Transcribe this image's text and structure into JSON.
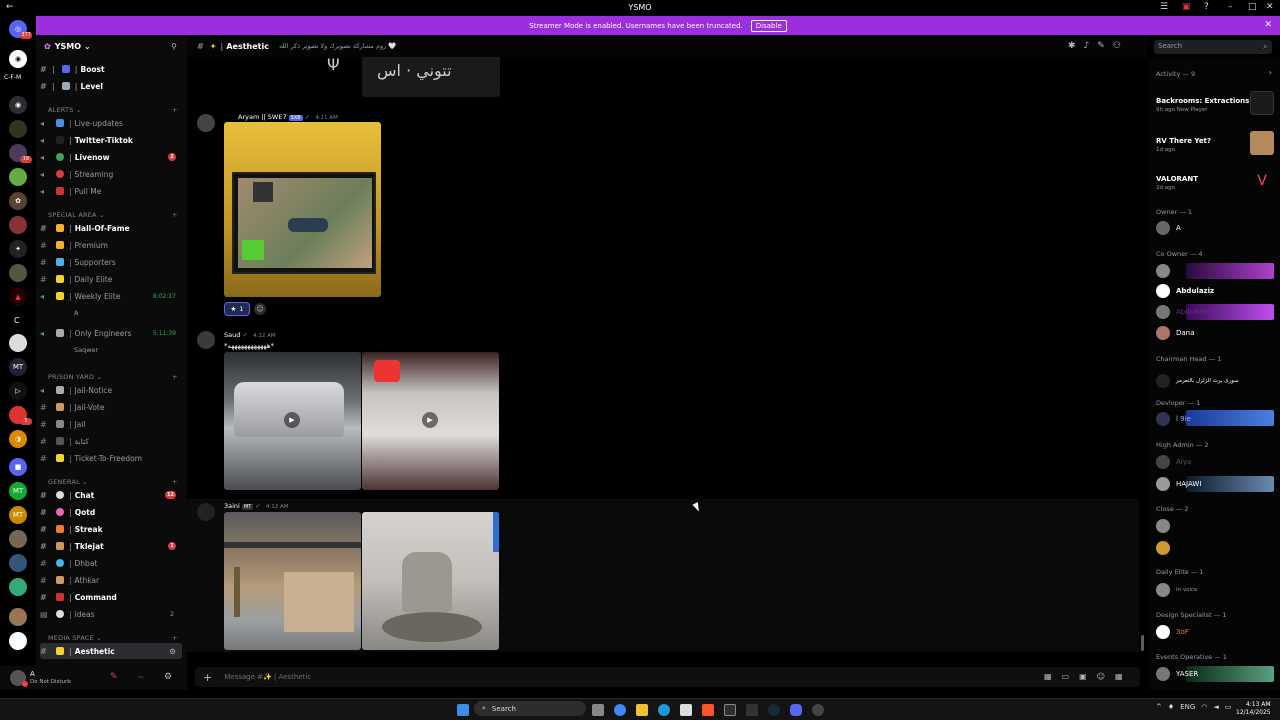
{
  "window": {
    "title": "YSMO"
  },
  "banner": {
    "text": "Streamer Mode is enabled. Usernames have been truncated.",
    "button": "Disable"
  },
  "rail": {
    "label_cfm": "C-F-M",
    "label_c": "C",
    "badges": [
      "377",
      "18",
      "5"
    ]
  },
  "server": {
    "name": "YSMO"
  },
  "channels": {
    "top": [
      {
        "label": "Boost",
        "bold": true
      },
      {
        "label": "Level",
        "bold": true
      }
    ],
    "categories": [
      {
        "name": "ALERTS",
        "items": [
          {
            "label": "Live-updates",
            "bold": false
          },
          {
            "label": "Twitter-Tiktok",
            "bold": true
          },
          {
            "label": "Livenow",
            "bold": true,
            "badge": "2"
          },
          {
            "label": "Streaming",
            "bold": false
          },
          {
            "label": "Pull Me",
            "bold": false
          }
        ]
      },
      {
        "name": "SPECIAL AREA",
        "items": [
          {
            "label": "Hall-Of-Fame",
            "bold": true
          },
          {
            "label": "Premium",
            "bold": false
          },
          {
            "label": "Supporters",
            "bold": false
          },
          {
            "label": "Daily Elite",
            "bold": false
          },
          {
            "label": "Weekly Elite",
            "bold": false,
            "time": "8:02:17"
          }
        ]
      },
      {
        "name": "PRISON YARD",
        "items": [
          {
            "label": "Jail-Notice",
            "bold": false
          },
          {
            "label": "Jail-Vote",
            "bold": false
          },
          {
            "label": "Jail",
            "bold": false
          },
          {
            "label": "كتابة",
            "bold": false
          },
          {
            "label": "Ticket-To-Freedom",
            "bold": false
          }
        ]
      },
      {
        "name": "GENERAL",
        "items": [
          {
            "label": "Chat",
            "bold": true,
            "badge": "12"
          },
          {
            "label": "Qotd",
            "bold": true
          },
          {
            "label": "Streak",
            "bold": true
          },
          {
            "label": "Tklejat",
            "bold": true,
            "badge": "1"
          },
          {
            "label": "Dhbat",
            "bold": false
          },
          {
            "label": "Athkar",
            "bold": false
          },
          {
            "label": "Command",
            "bold": true
          },
          {
            "label": "ideas",
            "bold": false,
            "count": "2"
          }
        ]
      },
      {
        "name": "MEDIA SPACE",
        "items": [
          {
            "label": "Aesthetic",
            "bold": true,
            "active": true
          }
        ]
      }
    ],
    "weekly_sub": "A",
    "engineers": {
      "label": "Only Engineers",
      "time": "5:11:39",
      "sub": "Saqwer"
    }
  },
  "user": {
    "name": "A",
    "status": "Do Not Disturb"
  },
  "chat": {
    "channel": "Aesthetic",
    "topic": "روم مشاركة تصويرك ولا تصوير ذكر الله 🤍",
    "top_text": "تتوني · اس",
    "messages": [
      {
        "author": "Aryam || SWE7",
        "time": "4:11 AM",
        "reaction": "1"
      },
      {
        "author": "Saud",
        "time": "4:12 AM",
        "text": "*ههههههههههههه*"
      },
      {
        "author": "3aini",
        "time": "4:12 AM"
      }
    ],
    "composer_placeholder": "Message #✨ | Aesthetic"
  },
  "search": {
    "placeholder": "Search"
  },
  "members": {
    "activity_header": "Activity — 9",
    "activities": [
      {
        "name": "Backrooms: Extractions",
        "meta": "9h ago  New Player",
        "thumb": "#1b1b1b"
      },
      {
        "name": "RV There Yet?",
        "meta": "1d ago",
        "thumb": "#b48a5c"
      },
      {
        "name": "VALORANT",
        "meta": "2d ago",
        "thumb": "#000"
      }
    ],
    "groups": [
      {
        "name": "Owner — 1",
        "members": [
          "A"
        ]
      },
      {
        "name": "Co Owner — 4",
        "members": [
          "",
          "Abdulaziz",
          "Abdulrahman",
          "Dana"
        ]
      },
      {
        "name": "Chairman Head — 1",
        "members": [
          "سورى يرت الزلزل بالتعرمر"
        ]
      },
      {
        "name": "Devloper — 1",
        "members": [
          "l 9le"
        ]
      },
      {
        "name": "High Admin — 2",
        "members": [
          "Alya",
          "HAJAWI"
        ]
      },
      {
        "name": "Close — 2",
        "members": [
          "",
          ""
        ]
      },
      {
        "name": "Daily Elite — 1",
        "members": [
          "In voice"
        ]
      },
      {
        "name": "Design Specialist — 1",
        "members": [
          "3oF"
        ]
      },
      {
        "name": "Events Operative — 1",
        "members": [
          "YASER"
        ]
      }
    ]
  },
  "taskbar": {
    "search": "Search",
    "lang": "ENG",
    "time": "4:13 AM",
    "date": "12/14/2025"
  },
  "colors": {
    "banner": "#9b2fe0",
    "accent": "#5865f2",
    "online": "#23a55a",
    "dnd": "#f23f43"
  }
}
